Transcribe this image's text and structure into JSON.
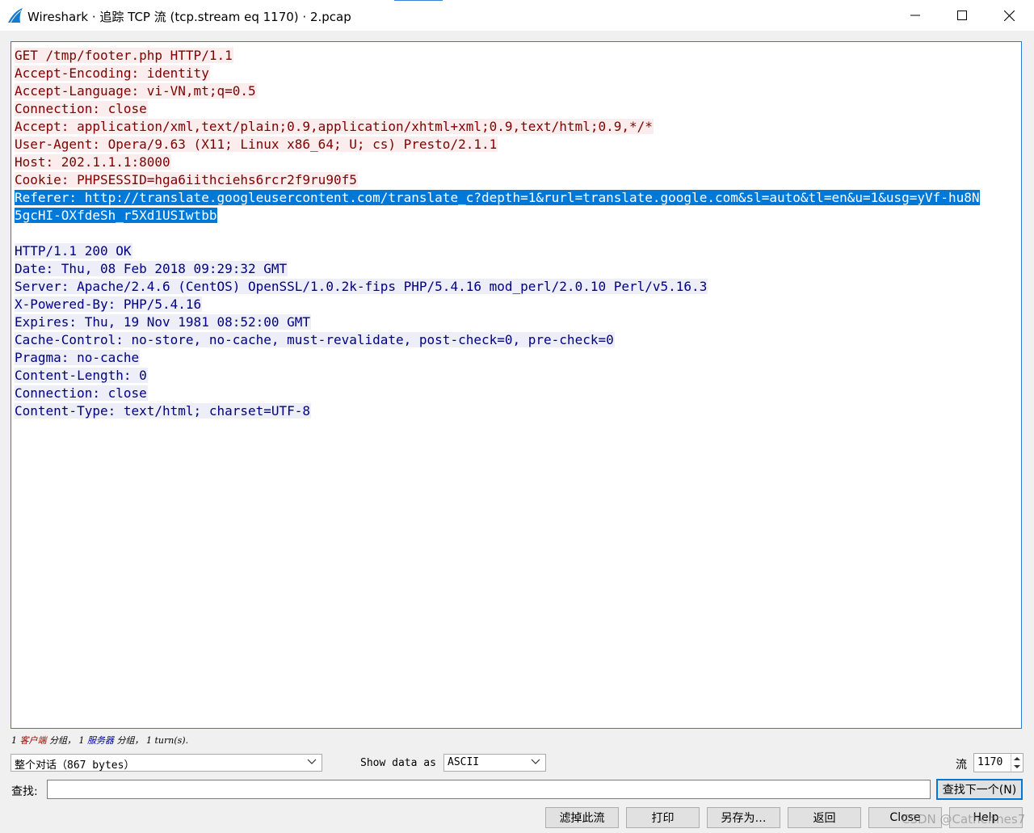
{
  "window": {
    "title": "Wireshark · 追踪 TCP 流 (tcp.stream eq 1170) · 2.pcap",
    "app_icon": "wireshark-fin-icon",
    "controls": [
      "minimize-icon",
      "maximize-icon",
      "close-icon"
    ]
  },
  "stream": {
    "lines": [
      {
        "text": "GET /tmp/footer.php HTTP/1.1",
        "side": "client"
      },
      {
        "text": "Accept-Encoding: identity",
        "side": "client"
      },
      {
        "text": "Accept-Language: vi-VN,mt;q=0.5",
        "side": "client"
      },
      {
        "text": "Connection: close",
        "side": "client"
      },
      {
        "text": "Accept: application/xml,text/plain;0.9,application/xhtml+xml;0.9,text/html;0.9,*/*",
        "side": "client"
      },
      {
        "text": "User-Agent: Opera/9.63 (X11; Linux x86_64; U; cs) Presto/2.1.1",
        "side": "client"
      },
      {
        "text": "Host: 202.1.1.1:8000",
        "side": "client"
      },
      {
        "text": "Cookie: PHPSESSID=hga6iithciehs6rcr2f9ru90f5",
        "side": "client"
      },
      {
        "text": "Referer: http://translate.googleusercontent.com/translate_c?depth=1&rurl=translate.google.com&sl=auto&tl=en&u=1&usg=yVf-hu8N",
        "side": "selected"
      },
      {
        "text": "5gcHI-OXfdeSh_r5Xd1USIwtbb",
        "side": "selected"
      },
      {
        "text": "",
        "side": "none"
      },
      {
        "text": "HTTP/1.1 200 OK",
        "side": "server"
      },
      {
        "text": "Date: Thu, 08 Feb 2018 09:29:32 GMT",
        "side": "server"
      },
      {
        "text": "Server: Apache/2.4.6 (CentOS) OpenSSL/1.0.2k-fips PHP/5.4.16 mod_perl/2.0.10 Perl/v5.16.3",
        "side": "server"
      },
      {
        "text": "X-Powered-By: PHP/5.4.16",
        "side": "server"
      },
      {
        "text": "Expires: Thu, 19 Nov 1981 08:52:00 GMT",
        "side": "server"
      },
      {
        "text": "Cache-Control: no-store, no-cache, must-revalidate, post-check=0, pre-check=0",
        "side": "server"
      },
      {
        "text": "Pragma: no-cache",
        "side": "server"
      },
      {
        "text": "Content-Length: 0",
        "side": "server"
      },
      {
        "text": "Connection: close",
        "side": "server"
      },
      {
        "text": "Content-Type: text/html; charset=UTF-8",
        "side": "server"
      }
    ],
    "colors": {
      "client_bg": "#fbeded",
      "client_fg": "#7f0000",
      "server_bg": "#eeeef9",
      "server_fg": "#000080",
      "selected_bg": "#0078d7"
    }
  },
  "summary": {
    "client_count": "1",
    "client_label": "客户端",
    "client_suffix": "分组，",
    "server_count": "1",
    "server_label": "服务器",
    "server_suffix": "分组，",
    "turns": "1 turn(s)."
  },
  "controls": {
    "conversation_select": "整个对话（867 bytes）",
    "show_data_label": "Show data as",
    "show_data_select": "ASCII",
    "stream_label": "流",
    "stream_value": "1170",
    "find_label": "查找:",
    "find_value": "",
    "find_next_button": "查找下一个(N)"
  },
  "buttons": {
    "filter_out": "滤掉此流",
    "print": "打印",
    "save_as": "另存为…",
    "back": "返回",
    "close": "Close",
    "help": "Help"
  },
  "watermark": "CSDN @Catherines7"
}
